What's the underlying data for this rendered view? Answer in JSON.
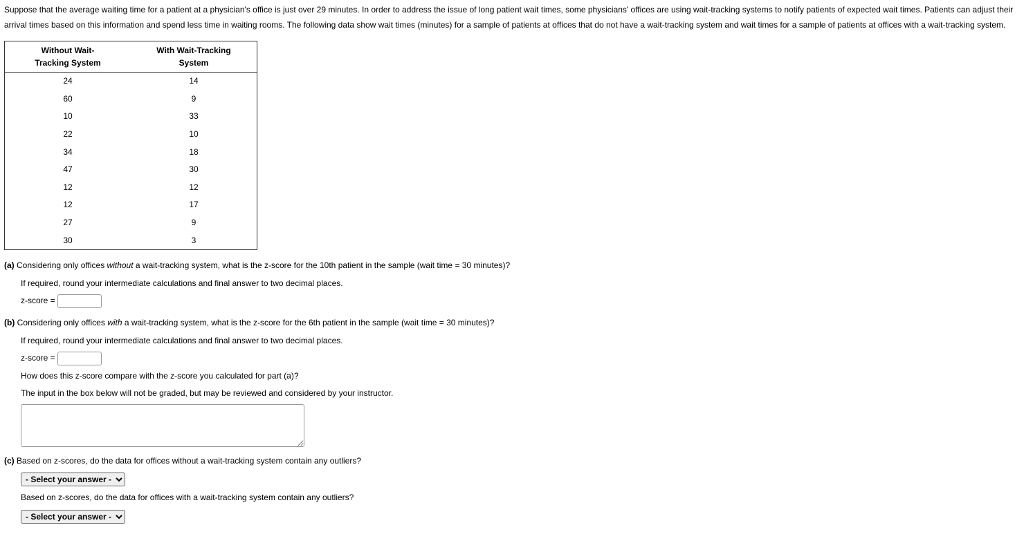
{
  "intro": "Suppose that the average waiting time for a patient at a physician's office is just over 29 minutes. In order to address the issue of long patient wait times, some physicians' offices are using wait-tracking systems to notify patients of expected wait times. Patients can adjust their arrival times based on this information and spend less time in waiting rooms. The following data show wait times (minutes) for a sample of patients at offices that do not have a wait-tracking system and wait times for a sample of patients at offices with a wait-tracking system.",
  "table": {
    "header_without_l1": "Without Wait-",
    "header_without_l2": "Tracking System",
    "header_with_l1": "With Wait-Tracking",
    "header_with_l2": "System",
    "rows": [
      {
        "w": "24",
        "t": "14"
      },
      {
        "w": "60",
        "t": "9"
      },
      {
        "w": "10",
        "t": "33"
      },
      {
        "w": "22",
        "t": "10"
      },
      {
        "w": "34",
        "t": "18"
      },
      {
        "w": "47",
        "t": "30"
      },
      {
        "w": "12",
        "t": "12"
      },
      {
        "w": "12",
        "t": "17"
      },
      {
        "w": "27",
        "t": "9"
      },
      {
        "w": "30",
        "t": "3"
      }
    ]
  },
  "a": {
    "label": "(a)",
    "q_pre": "Considering only offices ",
    "q_em": "without",
    "q_post": " a wait-tracking system, what is the z-score for the 10th patient in the sample (wait time = 30 minutes)?",
    "round": "If required, round your intermediate calculations and final answer to two decimal places.",
    "zlabel": "z-score ="
  },
  "b": {
    "label": "(b)",
    "q_pre": "Considering only offices ",
    "q_em": "with",
    "q_post": " a wait-tracking system, what is the z-score for the 6th patient in the sample (wait time = 30 minutes)?",
    "round": "If required, round your intermediate calculations and final answer to two decimal places.",
    "zlabel": "z-score =",
    "compare": "How does this z-score compare with the z-score you calculated for part (a)?",
    "note": "The input in the box below will not be graded, but may be reviewed and considered by your instructor."
  },
  "c": {
    "label": "(c)",
    "q1": "Based on z-scores, do the data for offices without a wait-tracking system contain any outliers?",
    "q2": "Based on z-scores, do the data for offices with a wait-tracking system contain any outliers?",
    "select_placeholder": "- Select your answer -"
  }
}
